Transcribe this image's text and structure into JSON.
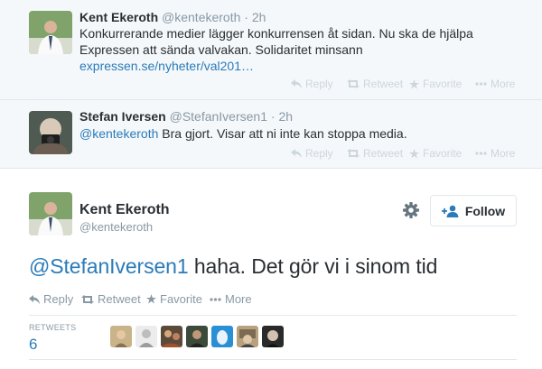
{
  "tweets": [
    {
      "fullname": "Kent Ekeroth",
      "screen_name": "@kentekeroth",
      "time": "· 2h",
      "text": "Konkurrerande medier lägger konkurrensen åt sidan. Nu ska de hjälpa Expressen att sända valvakan. Solidaritet minsann",
      "link": "expressen.se/nyheter/val201…",
      "actions": {
        "reply": "Reply",
        "retweet": "Retweet",
        "favorite": "Favorite",
        "more": "More"
      }
    },
    {
      "fullname": "Stefan Iversen",
      "screen_name": "@StefanIversen1",
      "time": "· 2h",
      "mention": "@kentekeroth",
      "text": " Bra gjort. Visar att ni inte kan stoppa media.",
      "actions": {
        "reply": "Reply",
        "retweet": "Retweet",
        "favorite": "Favorite",
        "more": "More"
      }
    }
  ],
  "main_tweet": {
    "fullname": "Kent Ekeroth",
    "screen_name": "@kentekeroth",
    "follow_label": "Follow",
    "mention": "@StefanIversen1",
    "text": " haha. Det gör vi i sinom tid",
    "actions": {
      "reply": "Reply",
      "retweet": "Retweet",
      "favorite": "Favorite",
      "more": "More"
    },
    "stats": {
      "retweets_label": "RETWEETS",
      "retweets_value": "6"
    },
    "retweeter_count": 7
  },
  "colors": {
    "link": "#2b7bb9",
    "muted": "#8899a6",
    "bg_thread": "#f5f8fa",
    "border": "#e1e8ed"
  },
  "icons": [
    "reply-icon",
    "retweet-icon",
    "favorite-icon",
    "more-icon",
    "gear-icon",
    "follow-person-icon"
  ]
}
